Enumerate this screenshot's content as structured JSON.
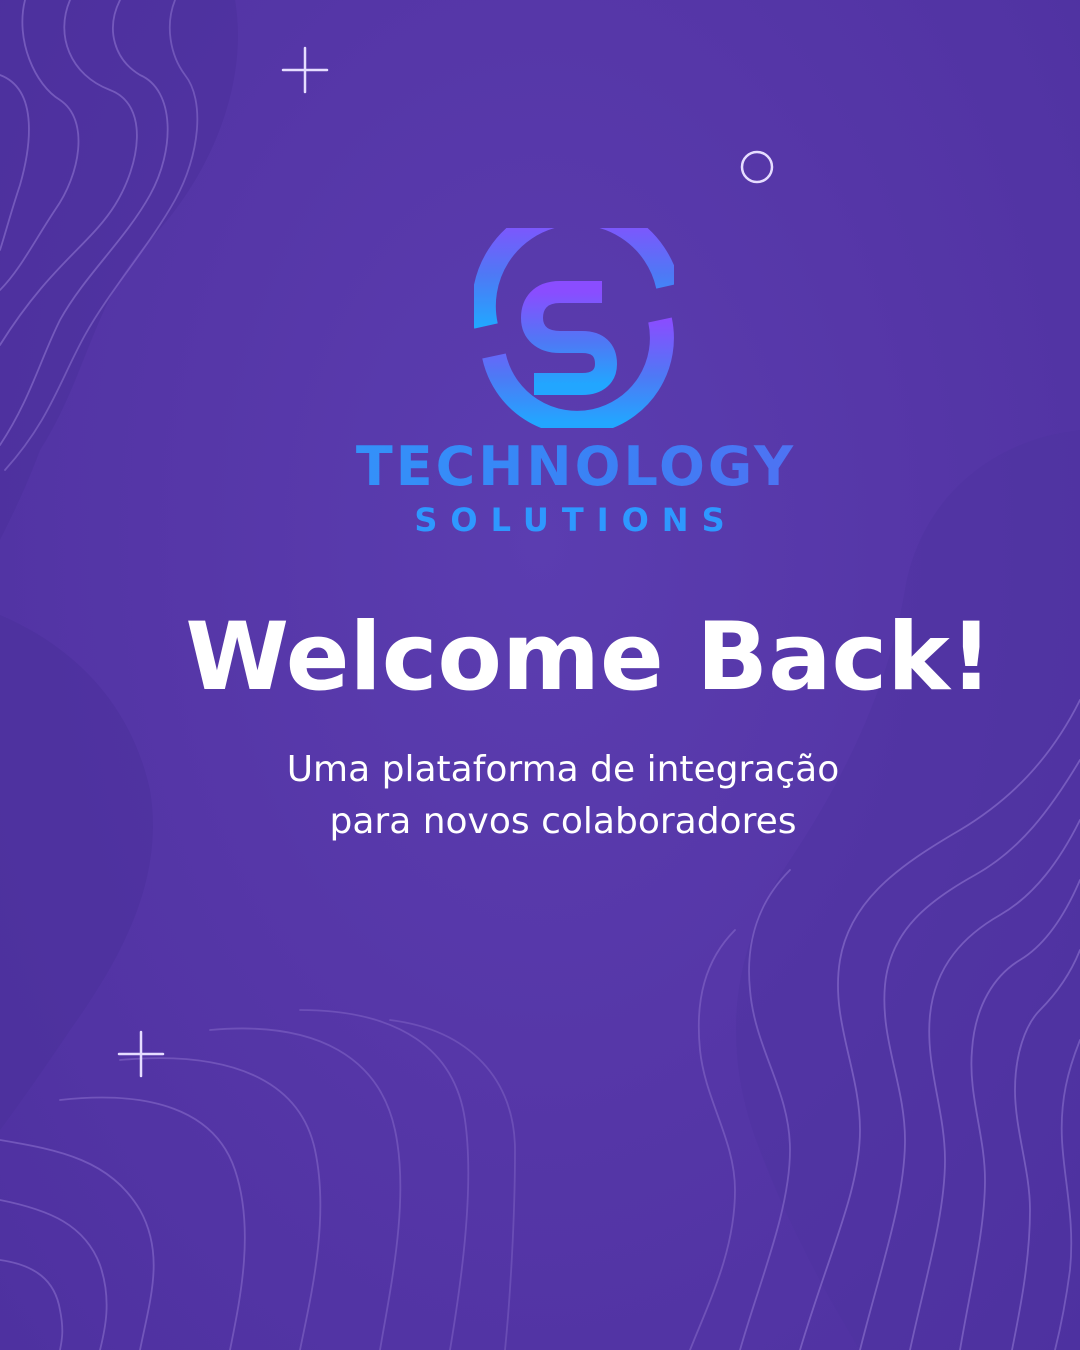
{
  "brand": {
    "name": "TECHNOLOGY",
    "tagline": "SOLUTIONS",
    "logo_icon": "s-circle-logo-icon",
    "gradient_colors": [
      "#8a4dff",
      "#2e98ff"
    ]
  },
  "headline": "Welcome Back!",
  "subtitle": {
    "line1": "Uma plataforma de integração",
    "line2": "para novos colaboradores"
  },
  "colors": {
    "background": "#5637a8",
    "text": "#ffffff",
    "decor_lines": "#a58ce0"
  },
  "decorations": {
    "icons": [
      "plus-icon",
      "circle-outline-icon",
      "plus-icon"
    ]
  }
}
